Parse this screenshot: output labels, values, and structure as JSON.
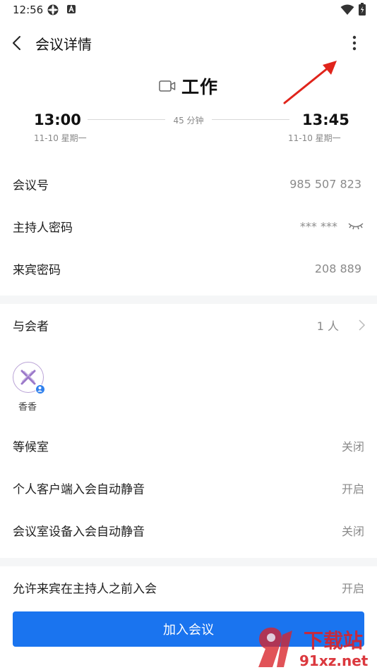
{
  "status_bar": {
    "time": "12:56"
  },
  "header": {
    "title": "会议详情"
  },
  "meeting": {
    "title": "工作",
    "start_time": "13:00",
    "start_date": "11-10 星期一",
    "end_time": "13:45",
    "end_date": "11-10 星期一",
    "duration": "45 分钟"
  },
  "info": {
    "meeting_id_label": "会议号",
    "meeting_id_value": "985 507 823",
    "host_pw_label": "主持人密码",
    "host_pw_value": "*** ***",
    "guest_pw_label": "来宾密码",
    "guest_pw_value": "208 889"
  },
  "participants": {
    "label": "与会者",
    "count": "1 人",
    "members": [
      {
        "name": "香香"
      }
    ]
  },
  "settings": {
    "waiting_room_label": "等候室",
    "waiting_room_value": "关闭",
    "personal_mute_label": "个人客户端入会自动静音",
    "personal_mute_value": "开启",
    "room_mute_label": "会议室设备入会自动静音",
    "room_mute_value": "关闭",
    "early_join_label": "允许来宾在主持人之前入会",
    "early_join_value": "开启"
  },
  "actions": {
    "join_label": "加入会议"
  },
  "watermark": {
    "brand_text": "下载站",
    "domain_text": "91xz.net"
  },
  "colors": {
    "accent": "#1a74ef",
    "annotation": "#e0241b",
    "watermark": "#d8232a"
  },
  "icons": [
    "back-arrow-icon",
    "more-vertical-icon",
    "video-camera-icon",
    "eye-closed-icon",
    "chevron-right-icon",
    "user-badge-icon"
  ]
}
